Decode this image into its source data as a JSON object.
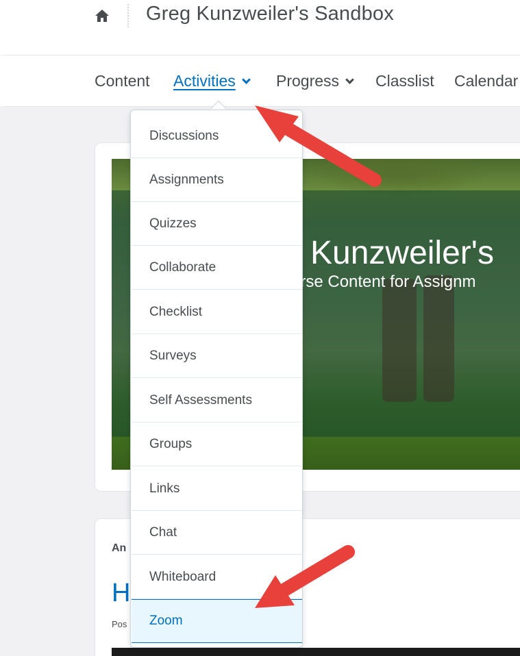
{
  "header": {
    "home_icon": "home-icon",
    "course_title": "Greg Kunzweiler's Sandbox"
  },
  "navbar": {
    "items": [
      {
        "label": "Content",
        "has_dropdown": false,
        "active": false
      },
      {
        "label": "Activities",
        "has_dropdown": true,
        "active": true
      },
      {
        "label": "Progress",
        "has_dropdown": true,
        "active": false
      },
      {
        "label": "Classlist",
        "has_dropdown": false,
        "active": false
      },
      {
        "label": "Calendar",
        "has_dropdown": false,
        "active": false
      }
    ]
  },
  "dropdown": {
    "items": [
      {
        "label": "Discussions"
      },
      {
        "label": "Assignments"
      },
      {
        "label": "Quizzes"
      },
      {
        "label": "Collaborate"
      },
      {
        "label": "Checklist"
      },
      {
        "label": "Surveys"
      },
      {
        "label": "Self Assessments"
      },
      {
        "label": "Groups"
      },
      {
        "label": "Links"
      },
      {
        "label": "Chat"
      },
      {
        "label": "Whiteboard"
      },
      {
        "label": "Zoom",
        "highlighted": true
      }
    ]
  },
  "banner": {
    "title": "Kunzweiler's",
    "subtitle": "urse Content for Assignm"
  },
  "announcements": {
    "label": "An",
    "heading": "H",
    "posted": "Pos"
  },
  "colors": {
    "accent": "#006fbf",
    "arrow": "#e8413b",
    "highlight_bg": "#e8f7fd"
  }
}
